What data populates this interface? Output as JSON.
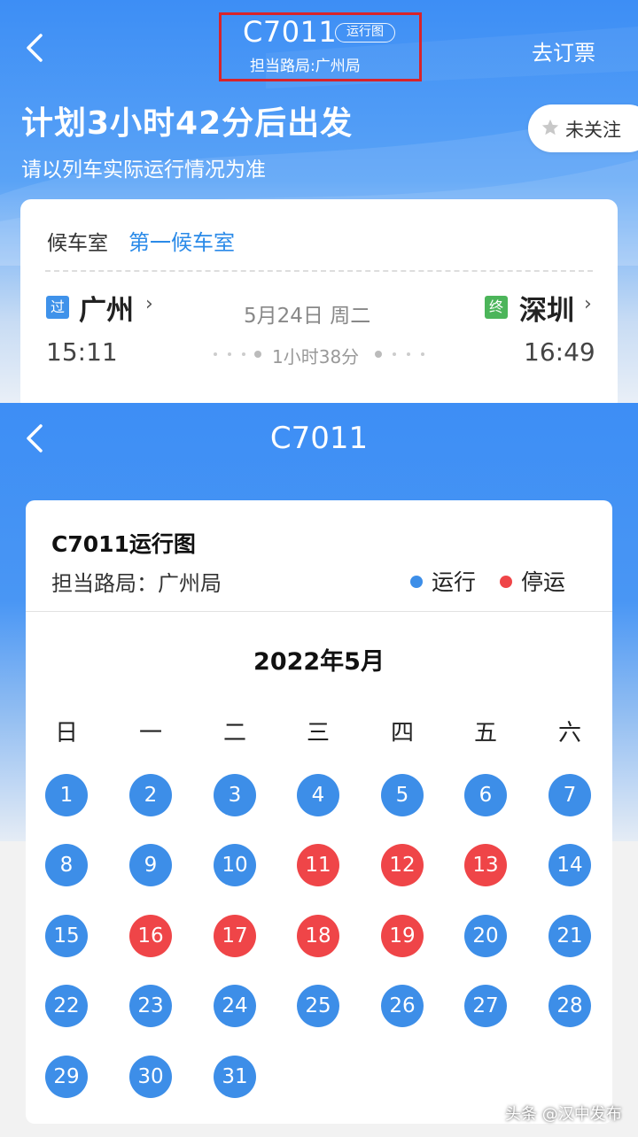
{
  "top_screen": {
    "train_no": "C7011",
    "chart_tag": "运行图",
    "bureau_line": "担当路局:广州局",
    "book_label": "去订票",
    "depart_text": "计划3小时42分后出发",
    "notice_text": "请以列车实际运行情况为准",
    "follow_label": "未关注",
    "icons": {
      "back": "back-arrow-icon",
      "star": "star-icon"
    },
    "info_card": {
      "waiting_label": "候车室",
      "waiting_value": "第一候车室",
      "from_badge": "过",
      "from_station": "广州",
      "to_badge": "终",
      "to_station": "深圳",
      "date": "5月24日 周二",
      "depart_time": "15:11",
      "arrive_time": "16:49",
      "duration": "1小时38分"
    }
  },
  "schedule_screen": {
    "header_title": "C7011",
    "card_title": "C7011运行图",
    "bureau_line": "担当路局：广州局",
    "legend": {
      "run_label": "运行",
      "stop_label": "停运"
    },
    "month_label": "2022年5月",
    "weekdays": [
      "日",
      "一",
      "二",
      "三",
      "四",
      "五",
      "六"
    ],
    "days": [
      {
        "d": "1",
        "s": "run"
      },
      {
        "d": "2",
        "s": "run"
      },
      {
        "d": "3",
        "s": "run"
      },
      {
        "d": "4",
        "s": "run"
      },
      {
        "d": "5",
        "s": "run"
      },
      {
        "d": "6",
        "s": "run"
      },
      {
        "d": "7",
        "s": "run"
      },
      {
        "d": "8",
        "s": "run"
      },
      {
        "d": "9",
        "s": "run"
      },
      {
        "d": "10",
        "s": "run"
      },
      {
        "d": "11",
        "s": "stop"
      },
      {
        "d": "12",
        "s": "stop"
      },
      {
        "d": "13",
        "s": "stop"
      },
      {
        "d": "14",
        "s": "run"
      },
      {
        "d": "15",
        "s": "run"
      },
      {
        "d": "16",
        "s": "stop"
      },
      {
        "d": "17",
        "s": "stop"
      },
      {
        "d": "18",
        "s": "stop"
      },
      {
        "d": "19",
        "s": "stop"
      },
      {
        "d": "20",
        "s": "run"
      },
      {
        "d": "21",
        "s": "run"
      },
      {
        "d": "22",
        "s": "run"
      },
      {
        "d": "23",
        "s": "run"
      },
      {
        "d": "24",
        "s": "run"
      },
      {
        "d": "25",
        "s": "run"
      },
      {
        "d": "26",
        "s": "run"
      },
      {
        "d": "27",
        "s": "run"
      },
      {
        "d": "28",
        "s": "run"
      },
      {
        "d": "29",
        "s": "run"
      },
      {
        "d": "30",
        "s": "run"
      },
      {
        "d": "31",
        "s": "run"
      }
    ],
    "colors": {
      "run": "#3d8ee8",
      "stop": "#ef4548"
    }
  },
  "watermark": "头条 @汉中发布"
}
